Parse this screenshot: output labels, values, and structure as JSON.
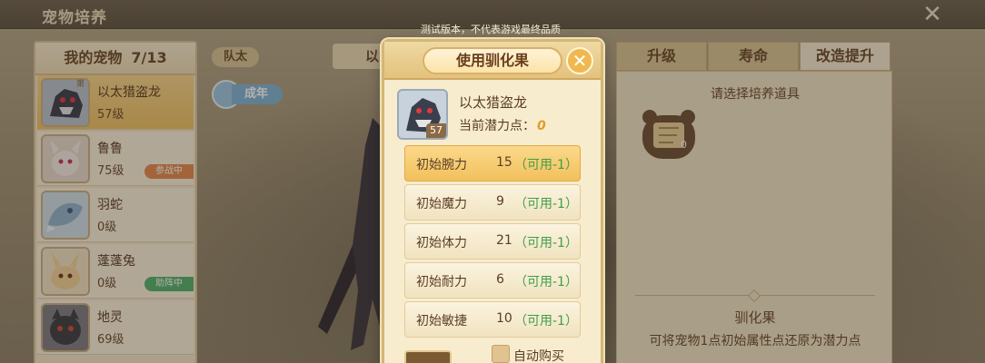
{
  "window": {
    "title": "宠物培养",
    "notice": "测试版本，不代表游戏最终品质"
  },
  "pet_panel": {
    "header": "我的宠物",
    "count": "7/13",
    "items": [
      {
        "name": "以太猎盗龙",
        "level": "57级",
        "tag": "",
        "selected": true,
        "corner": "第"
      },
      {
        "name": "鲁鲁",
        "level": "75级",
        "tag": "参战中",
        "tag_color": "#e48a4f"
      },
      {
        "name": "羽蛇",
        "level": "0级",
        "tag": ""
      },
      {
        "name": "蓬蓬兔",
        "level": "0级",
        "tag": "助阵中",
        "tag_color": "#55b26d"
      },
      {
        "name": "地灵",
        "level": "69级",
        "tag": ""
      }
    ]
  },
  "middle": {
    "team_label": "队太",
    "adult_badge": "成年",
    "tab_behind": "以"
  },
  "right_panel": {
    "tabs": [
      "升级",
      "寿命",
      "改造提升"
    ],
    "active_tab": "改造提升",
    "hint": "请选择培养道具",
    "slot_count": "0",
    "item_name": "驯化果",
    "item_desc": "可将宠物1点初始属性点还原为潜力点"
  },
  "modal": {
    "title": "使用驯化果",
    "close_icon": "close-icon",
    "pet": {
      "name": "以太猎盗龙",
      "level": "57",
      "potential_label": "当前潜力点：",
      "potential_value": "0"
    },
    "attributes": [
      {
        "label": "初始腕力",
        "value": "15",
        "avail": "（可用-1）",
        "selected": true
      },
      {
        "label": "初始魔力",
        "value": "9",
        "avail": "（可用-1）"
      },
      {
        "label": "初始体力",
        "value": "21",
        "avail": "（可用-1）"
      },
      {
        "label": "初始耐力",
        "value": "6",
        "avail": "（可用-1）"
      },
      {
        "label": "初始敏捷",
        "value": "10",
        "avail": "（可用-1）"
      }
    ],
    "auto_buy_label": "自动购买"
  },
  "colors": {
    "accent": "#f0b84e",
    "available_green": "#3e9e4a",
    "potential_orange": "#e59a2a"
  }
}
